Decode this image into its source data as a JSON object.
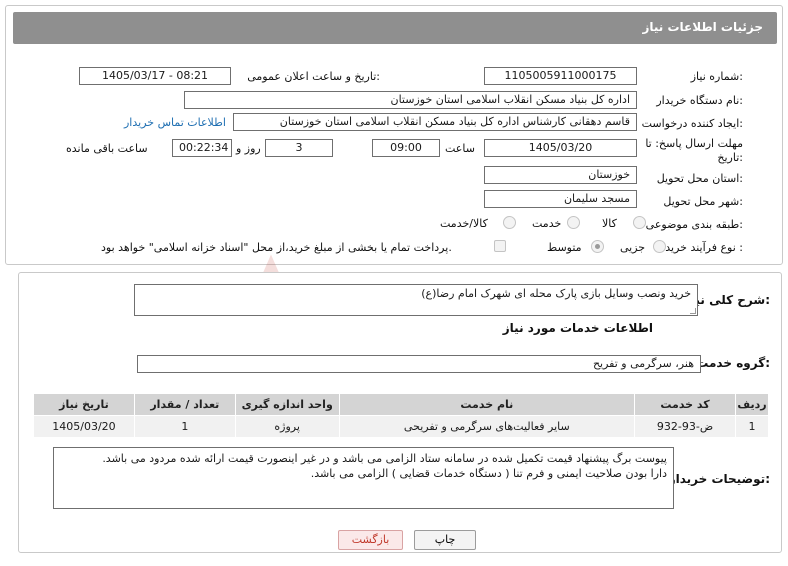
{
  "header": {
    "title": "جزئیات اطلاعات نیاز"
  },
  "fields": {
    "need_number_label": "شماره نیاز:",
    "need_number": "1105005911000175",
    "announce_label": "تاریخ و ساعت اعلان عمومی:",
    "announce_value": "1405/03/17 - 08:21",
    "buyer_org_label": "نام دستگاه خریدار:",
    "buyer_org": "اداره کل بنیاد مسکن انقلاب اسلامی استان خوزستان",
    "requester_label": "ایجاد کننده درخواست:",
    "requester": "قاسم دهقانی کارشناس اداره کل بنیاد مسکن انقلاب اسلامی استان خوزستان",
    "contact_link": "اطلاعات تماس خریدار",
    "deadline_label_1": "مهلت ارسال پاسخ: تا",
    "deadline_label_2": "تاریخ:",
    "deadline_date": "1405/03/20",
    "time_label": "ساعت",
    "deadline_time": "09:00",
    "days_value": "3",
    "days_label": "روز و",
    "remaining_time": "00:22:34",
    "remaining_label": "ساعت باقی مانده",
    "province_label": "استان محل تحویل:",
    "province": "خوزستان",
    "city_label": "شهر محل تحویل:",
    "city": "مسجد سلیمان",
    "category_label": "طبقه بندی موضوعی:",
    "category_options": [
      "کالا",
      "خدمت",
      "کالا/خدمت"
    ],
    "process_label": "نوع فرآیند خرید :",
    "process_options": [
      "جزیی",
      "متوسط"
    ],
    "payment_note": "پرداخت تمام یا بخشی از مبلغ خرید،از محل \"اسناد خزانه اسلامی\" خواهد بود."
  },
  "summary": {
    "label": "شرح کلی نیاز:",
    "value": "خرید ونصب وسایل بازی پارک محله ای شهرک امام رضا(ع)"
  },
  "services": {
    "section_title": "اطلاعات خدمات مورد نیاز",
    "group_label": "گروه خدمت:",
    "group_value": "هنر، سرگرمی و تفریح",
    "columns": [
      "ردیف",
      "کد خدمت",
      "نام خدمت",
      "واحد اندازه گیری",
      "تعداد / مقدار",
      "تاریخ نیاز"
    ],
    "rows": [
      [
        "1",
        "ض-93-932",
        "سایر فعالیت‌های سرگرمی و تفریحی",
        "پروژه",
        "1",
        "1405/03/20"
      ]
    ]
  },
  "buyer_notes": {
    "label": "توضیحات خریدار:",
    "line1": "پیوست برگ پیشنهاد قیمت تکمیل شده در سامانه ستاد الزامی می باشد و در غیر اینصورت  قیمت ارائه شده مردود می باشد.",
    "line2": "دارا بودن صلاحیت ایمنی و فرم تنا ( دستگاه خدمات قضایی ) الزامی می باشد."
  },
  "buttons": {
    "print": "چاپ",
    "back": "بازگشت"
  },
  "watermark": {
    "text": "AriaTender.net"
  },
  "colors": {
    "header": "#8f8f8f",
    "link": "#1f6fb2",
    "back_text": "#c0392b",
    "back_bg": "#fbe9e9",
    "watermark": "#c0392b"
  }
}
